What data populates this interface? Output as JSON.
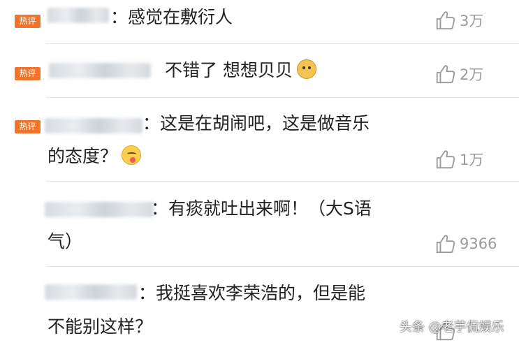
{
  "badge_label": "热评",
  "comments": [
    {
      "hot": true,
      "text": "：感觉在敷衍人",
      "likes": "3万"
    },
    {
      "hot": true,
      "text": "不错了 想想贝贝",
      "emoji": "doge-emoji",
      "likes": "2万"
    },
    {
      "hot": true,
      "line1": "：这是在胡闹吧，这是做音乐",
      "line2": "的态度？",
      "emoji": "yum-emoji",
      "likes": "1万"
    },
    {
      "hot": false,
      "line1": "：有痰就吐出来啊！（大S语",
      "line2": "气）",
      "likes": "9366"
    },
    {
      "hot": false,
      "line1": "：我挺喜欢李荣浩的，但是能",
      "line2": "不能别这样？",
      "likes": ""
    }
  ],
  "watermark": "头条 @老芋侃娱乐",
  "colors": {
    "badge": "#f0742a",
    "text": "#222222",
    "count": "#9a9a9a",
    "divider": "#e6e6e6"
  },
  "icons": {
    "like": "thumbs-up-icon"
  }
}
